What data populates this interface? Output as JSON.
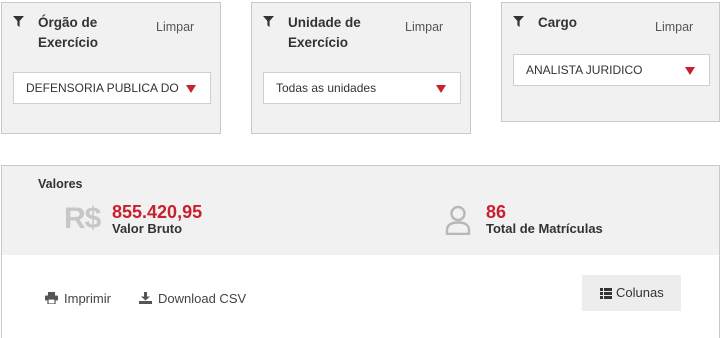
{
  "filters": [
    {
      "title_line1": "Órgão de",
      "title_line2": "Exercício",
      "clear_label": "Limpar",
      "selected": "DEFENSORIA PUBLICA DO ESTADO"
    },
    {
      "title_line1": "Unidade de",
      "title_line2": "Exercício",
      "clear_label": "Limpar",
      "selected": "Todas as unidades"
    },
    {
      "title_line1": "Cargo",
      "title_line2": "",
      "clear_label": "Limpar",
      "selected": "ANALISTA JURIDICO"
    }
  ],
  "values": {
    "section_label": "Valores",
    "currency_symbol": "R$",
    "gross_value": "855.420,95",
    "gross_label": "Valor Bruto",
    "registrations_value": "86",
    "registrations_label": "Total de Matrículas"
  },
  "actions": {
    "print_label": "Imprimir",
    "download_label": "Download CSV",
    "columns_label": "Colunas"
  },
  "colors": {
    "accent": "#c8202e",
    "panel_bg": "#f1f1f1",
    "border": "#c9c9c9",
    "muted_icon": "#c7c7c7"
  },
  "icons": [
    "filter-icon",
    "dropdown-caret-icon",
    "currency-icon",
    "user-icon",
    "print-icon",
    "download-icon",
    "columns-icon"
  ]
}
